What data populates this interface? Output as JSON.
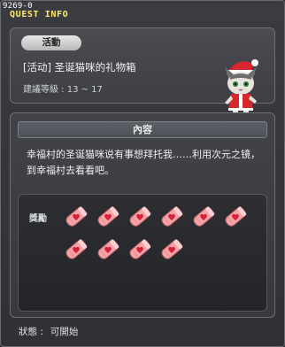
{
  "window": {
    "quest_id": "9269-0",
    "title": "QUEST INFO"
  },
  "quest": {
    "category_tag": "活動",
    "name": "[活动] 圣诞猫咪的礼物箱",
    "level_label": "建議等級 : 13 ~ 17",
    "npc_icon": "santa-cat-npc-icon"
  },
  "content": {
    "header": "內容",
    "description": "幸福村的圣诞猫咪说有事想拜托我……利用次元之镜，到幸福村去看看吧。"
  },
  "rewards": {
    "label": "獎勵",
    "items": [
      {
        "icon": "pink-gift-item-icon"
      },
      {
        "icon": "pink-gift-item-icon"
      },
      {
        "icon": "pink-gift-item-icon"
      },
      {
        "icon": "pink-gift-item-icon"
      },
      {
        "icon": "pink-gift-item-icon"
      },
      {
        "icon": "pink-gift-item-icon"
      },
      {
        "icon": "pink-gift-item-icon"
      },
      {
        "icon": "pink-gift-item-icon"
      },
      {
        "icon": "pink-gift-item-icon"
      },
      {
        "icon": "pink-gift-item-icon"
      }
    ]
  },
  "status": {
    "label": "狀態 :",
    "value": "可開始"
  },
  "colors": {
    "title_accent": "#ffe86a",
    "reward_pink": "#f5a3a6",
    "reward_heart": "#d4223a"
  }
}
